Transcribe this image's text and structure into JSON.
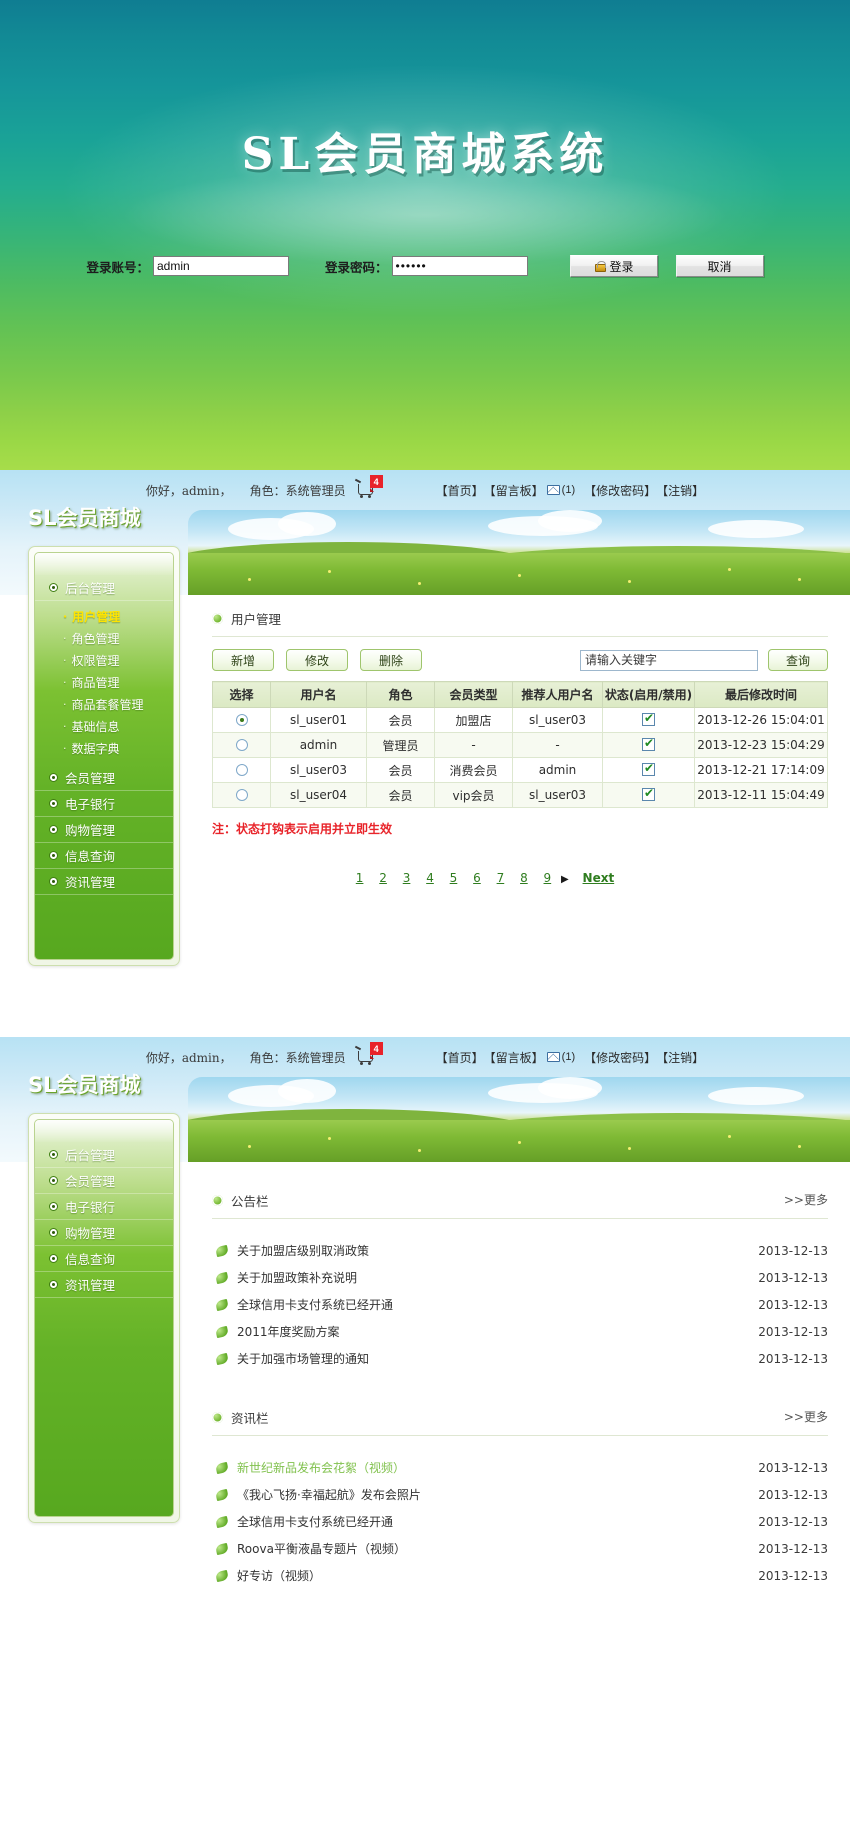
{
  "login": {
    "title": "SL会员商城系统",
    "account_label": "登录账号：",
    "account_value": "admin",
    "password_label": "登录密码：",
    "password_value": "••••••",
    "login_button": "登录",
    "cancel_button": "取消"
  },
  "topbar": {
    "greeting": "你好，admin，",
    "role": "角色：系统管理员",
    "cart_badge": "4",
    "home_link": "【首页】",
    "board_link": "【留言板】",
    "mail_count": "(1)",
    "password_link": "【修改密码】",
    "logout_link": "【注销】"
  },
  "sidebar": {
    "logo": "SL会员商城",
    "items": [
      {
        "label": "后台管理"
      },
      {
        "label": "会员管理"
      },
      {
        "label": "电子银行"
      },
      {
        "label": "购物管理"
      },
      {
        "label": "信息查询"
      },
      {
        "label": "资讯管理"
      }
    ],
    "sub_items": [
      {
        "label": "用户管理",
        "active": true
      },
      {
        "label": "角色管理",
        "active": false
      },
      {
        "label": "权限管理",
        "active": false
      },
      {
        "label": "商品管理",
        "active": false
      },
      {
        "label": "商品套餐管理",
        "active": false
      },
      {
        "label": "基础信息",
        "active": false
      },
      {
        "label": "数据字典",
        "active": false
      }
    ]
  },
  "user_page": {
    "section_title": "用户管理",
    "buttons": {
      "add": "新增",
      "edit": "修改",
      "delete": "删除",
      "query": "查询"
    },
    "search_placeholder": "请输入关键字",
    "columns": [
      "选择",
      "用户名",
      "角色",
      "会员类型",
      "推荐人用户名",
      "状态(启用/禁用)",
      "最后修改时间"
    ],
    "rows": [
      {
        "selected": true,
        "username": "sl_user01",
        "role": "会员",
        "member_type": "加盟店",
        "referrer": "sl_user03",
        "enabled": true,
        "modified": "2013-12-26 15:04:01"
      },
      {
        "selected": false,
        "username": "admin",
        "role": "管理员",
        "member_type": "-",
        "referrer": "-",
        "enabled": true,
        "modified": "2013-12-23 15:04:29"
      },
      {
        "selected": false,
        "username": "sl_user03",
        "role": "会员",
        "member_type": "消费会员",
        "referrer": "admin",
        "enabled": true,
        "modified": "2013-12-21 17:14:09"
      },
      {
        "selected": false,
        "username": "sl_user04",
        "role": "会员",
        "member_type": "vip会员",
        "referrer": "sl_user03",
        "enabled": true,
        "modified": "2013-12-11 15:04:49"
      }
    ],
    "note": "注：状态打钩表示启用并立即生效",
    "pages": [
      "1",
      "2",
      "3",
      "4",
      "5",
      "6",
      "7",
      "8",
      "9"
    ],
    "next_label": "Next"
  },
  "home_page": {
    "bulletin": {
      "title": "公告栏",
      "more": ">>更多",
      "items": [
        {
          "text": "关于加盟店级别取消政策",
          "date": "2013-12-13",
          "highlight": false
        },
        {
          "text": "关于加盟政策补充说明",
          "date": "2013-12-13",
          "highlight": false
        },
        {
          "text": "全球信用卡支付系统已经开通",
          "date": "2013-12-13",
          "highlight": false
        },
        {
          "text": "2011年度奖励方案",
          "date": "2013-12-13",
          "highlight": false
        },
        {
          "text": "关于加强市场管理的通知",
          "date": "2013-12-13",
          "highlight": false
        }
      ]
    },
    "news": {
      "title": "资讯栏",
      "more": ">>更多",
      "items": [
        {
          "text": "新世纪新品发布会花絮（视频）",
          "date": "2013-12-13",
          "highlight": true
        },
        {
          "text": "《我心飞扬·幸福起航》发布会照片",
          "date": "2013-12-13",
          "highlight": false
        },
        {
          "text": "全球信用卡支付系统已经开通",
          "date": "2013-12-13",
          "highlight": false
        },
        {
          "text": "Roova平衡液晶专题片（视频）",
          "date": "2013-12-13",
          "highlight": false
        },
        {
          "text": "好专访（视频）",
          "date": "2013-12-13",
          "highlight": false
        }
      ]
    }
  }
}
